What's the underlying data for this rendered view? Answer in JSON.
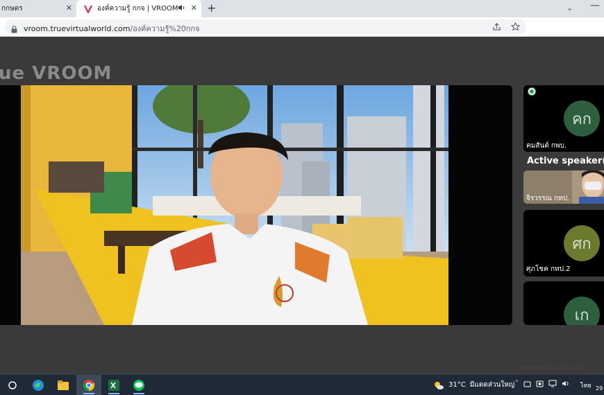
{
  "browser": {
    "tabs": [
      {
        "title": "กกษตร",
        "active": false
      },
      {
        "title": "องค์ความรู้ กกจ | VROOM",
        "active": true
      }
    ],
    "url_host": "vroom.truevirtualworld.com",
    "url_path": "/องค์ความรู้%20กกจ"
  },
  "page": {
    "logo_text": "ue VROOM",
    "participants": [
      {
        "initials": "คก",
        "name": "คมสันต์ กพบ.",
        "avatar_color": "#2d5e3d"
      },
      {
        "name": "จิรวรรณ กทป."
      },
      {
        "initials": "ศก",
        "name": "ศุภโชค กทป.2",
        "avatar_color": "#6b7a2d"
      },
      {
        "initials": "เก",
        "avatar_color": "#2d5e3d"
      }
    ],
    "active_speaker_title": "Active speaker(s)",
    "footer_text": "VERSION 2022.10.3 R0"
  },
  "taskbar": {
    "temperature": "31°C",
    "weather_text": "มีแดดส่วนใหญ่",
    "language": "ไทย",
    "clock": "29"
  },
  "colors": {
    "accent_green": "#2d9c4a",
    "taskbar_bg": "#1f2a36"
  }
}
